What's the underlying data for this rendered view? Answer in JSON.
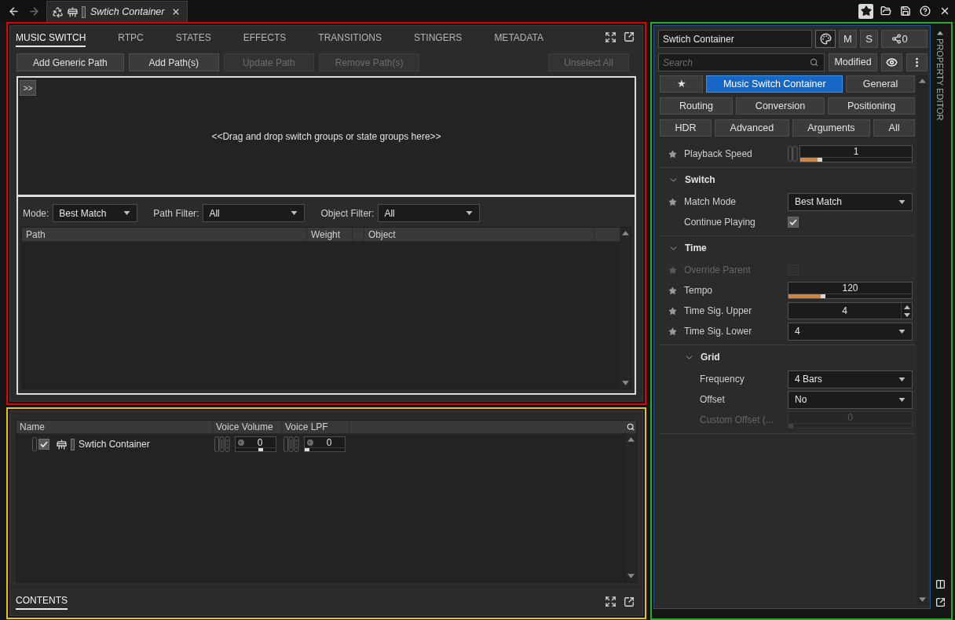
{
  "top_bar": {
    "nav": {
      "back_enabled": true,
      "forward_enabled": false
    },
    "tab": {
      "title": "Swtich Container"
    },
    "tool_buttons": [
      {
        "kind": "favorites",
        "on": true
      },
      {
        "kind": "open",
        "on": false
      },
      {
        "kind": "save",
        "on": false
      },
      {
        "kind": "help",
        "on": false
      },
      {
        "kind": "close",
        "on": false
      }
    ]
  },
  "music_switch_panel": {
    "tabs": [
      {
        "label": "MUSIC SWITCH",
        "selected": true
      },
      {
        "label": "RTPC",
        "selected": false
      },
      {
        "label": "STATES",
        "selected": false
      },
      {
        "label": "EFFECTS",
        "selected": false
      },
      {
        "label": "TRANSITIONS",
        "selected": false
      },
      {
        "label": "STINGERS",
        "selected": false
      },
      {
        "label": "METADATA",
        "selected": false
      }
    ],
    "path_buttons": [
      {
        "label": "Add Generic Path",
        "disabled": false
      },
      {
        "label": "Add Path(s)",
        "disabled": false
      },
      {
        "label": "Update Path",
        "disabled": true
      },
      {
        "label": "Remove Path(s)",
        "disabled": true
      }
    ],
    "unselect_button": {
      "label": "Unselect All",
      "disabled": true
    },
    "drop_area": {
      "toggle": ">>",
      "hint": "<<Drag and drop switch groups or state groups here>>"
    },
    "filters": [
      {
        "label": "Mode:",
        "value": "Best Match"
      },
      {
        "label": "Path Filter:",
        "value": "All"
      },
      {
        "label": "Object Filter:",
        "value": "All"
      }
    ],
    "table": {
      "columns": [
        {
          "label": "Path"
        },
        {
          "label": "Weight"
        },
        {
          "label": "Object"
        }
      ]
    }
  },
  "contents_panel": {
    "table": {
      "columns": [
        {
          "label": "Name"
        },
        {
          "label": "Voice Volume"
        },
        {
          "label": "Voice LPF"
        }
      ],
      "rows": [
        {
          "name": "Swtich Container",
          "checked": true,
          "voice_volume": {
            "value": "0",
            "level": 0.65
          },
          "voice_lpf": {
            "value": "0",
            "level": 0
          }
        }
      ]
    },
    "tabs": [
      {
        "label": "CONTENTS",
        "selected": true
      }
    ]
  },
  "property_editor": {
    "title": "PROPERTY EDITOR",
    "name": "Swtich Container",
    "mute": "M",
    "solo": "S",
    "share_count": "0",
    "search": {
      "placeholder": "Search"
    },
    "filter_button": "Modified",
    "tab_rows": [
      [
        {
          "label": "★",
          "selected": false
        },
        {
          "label": "Music Switch Container",
          "selected": true
        },
        {
          "label": "General",
          "selected": false
        }
      ],
      [
        {
          "label": "Routing",
          "selected": false
        },
        {
          "label": "Conversion",
          "selected": false
        },
        {
          "label": "Positioning",
          "selected": false
        }
      ],
      [
        {
          "label": "HDR",
          "selected": false
        },
        {
          "label": "Advanced",
          "selected": false
        },
        {
          "label": "Arguments",
          "selected": false
        },
        {
          "label": "All",
          "selected": false
        }
      ]
    ],
    "properties": [
      {
        "kind": "slider",
        "label": "Playback Speed",
        "starred": true,
        "disabled": false,
        "side_icon": true,
        "value": "1",
        "level": 0.2
      }
    ],
    "groups": [
      {
        "title": "Switch",
        "expanded": true,
        "properties": [
          {
            "kind": "dropdown",
            "label": "Match Mode",
            "starred": true,
            "disabled": false,
            "value": "Best Match"
          },
          {
            "kind": "checkbox",
            "label": "Continue Playing",
            "starred": false,
            "disabled": false,
            "checked": true
          }
        ]
      },
      {
        "title": "Time",
        "expanded": true,
        "properties": [
          {
            "kind": "checkbox",
            "label": "Override Parent",
            "starred": true,
            "disabled": true,
            "checked": false
          },
          {
            "kind": "slider",
            "label": "Tempo",
            "starred": true,
            "disabled": false,
            "side_icon": false,
            "value": "120",
            "level": 0.3
          },
          {
            "kind": "spinner",
            "label": "Time Sig. Upper",
            "starred": true,
            "disabled": false,
            "value": "4"
          },
          {
            "kind": "dropdown",
            "label": "Time Sig. Lower",
            "starred": true,
            "disabled": false,
            "value": "4"
          }
        ],
        "children": [
          {
            "title": "Grid",
            "expanded": true,
            "properties": [
              {
                "kind": "dropdown",
                "label": "Frequency",
                "starred": false,
                "disabled": false,
                "value": "4 Bars"
              },
              {
                "kind": "dropdown",
                "label": "Offset",
                "starred": false,
                "disabled": false,
                "value": "No"
              },
              {
                "kind": "slider",
                "label": "Custom Offset (...",
                "starred": false,
                "disabled": true,
                "side_icon": false,
                "value": "0",
                "level": 0
              }
            ]
          }
        ]
      }
    ]
  }
}
